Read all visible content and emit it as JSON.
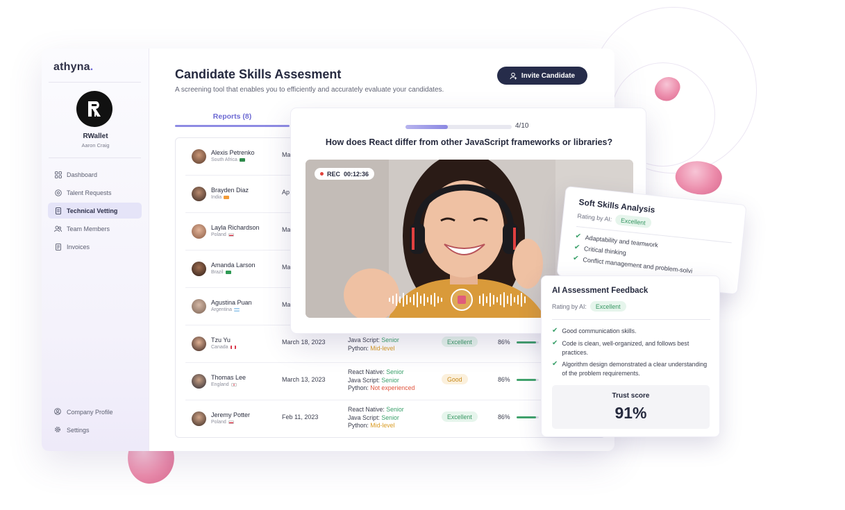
{
  "sidebar": {
    "logo": "athyna",
    "logo_dot": ".",
    "company": "RWallet",
    "person": "Aaron Craig",
    "nav": [
      {
        "label": "Dashboard",
        "icon": "grid-icon"
      },
      {
        "label": "Talent Requests",
        "icon": "target-icon"
      },
      {
        "label": "Technical Vetting",
        "icon": "document-icon",
        "active": true
      },
      {
        "label": "Team Members",
        "icon": "users-icon"
      },
      {
        "label": "Invoices",
        "icon": "invoice-icon"
      }
    ],
    "bottom": [
      {
        "label": "Company Profile",
        "icon": "profile-icon"
      },
      {
        "label": "Settings",
        "icon": "gear-icon"
      }
    ]
  },
  "header": {
    "title": "Candidate Skills Assesment",
    "subtitle": "A screening tool that enables you to efficiently and accurately evaluate your candidates.",
    "invite_label": "Invite Candidate"
  },
  "tabs": {
    "reports": "Reports (8)"
  },
  "candidates": [
    {
      "name": "Alexis Petrenko",
      "country": "South Africa",
      "date": "Ma",
      "flag": "#2f8a4b"
    },
    {
      "name": "Brayden Diaz",
      "country": "India",
      "date": "Ap",
      "flag": "#f29b38"
    },
    {
      "name": "Layla Richardson",
      "country": "Poland",
      "date": "Ma",
      "flag": "#d9374a"
    },
    {
      "name": "Amanda Larson",
      "country": "Brazil",
      "date": "Ma",
      "flag": "#2f9a54"
    },
    {
      "name": "Agustina Puan",
      "country": "Argentina",
      "date": "Ma",
      "flag": "#8fc3ea"
    },
    {
      "name": "Tzu Yu",
      "country": "Canada",
      "date": "March 18, 2023",
      "flag": "#d9374a",
      "skills": [
        {
          "lang": "Java Script:",
          "level": "Senior",
          "cls": "senior"
        },
        {
          "lang": "Python:",
          "level": "Mid-level",
          "cls": "mid"
        }
      ],
      "rating": "Excellent",
      "rating_cls": "ex",
      "pct": "86%",
      "pct_val": 0.86
    },
    {
      "name": "Thomas Lee",
      "country": "England",
      "date": "March 13, 2023",
      "flag": "#d9374a",
      "skills": [
        {
          "lang": "React Native:",
          "level": "Senior",
          "cls": "senior"
        },
        {
          "lang": "Java Script:",
          "level": "Senior",
          "cls": "senior"
        },
        {
          "lang": "Python:",
          "level": "Not experienced",
          "cls": "none"
        }
      ],
      "rating": "Good",
      "rating_cls": "gd",
      "pct": "86%",
      "pct_val": 0.86
    },
    {
      "name": "Jeremy Potter",
      "country": "Poland",
      "date": "Feb 11, 2023",
      "flag": "#d9374a",
      "skills": [
        {
          "lang": "React Native:",
          "level": "Senior",
          "cls": "senior"
        },
        {
          "lang": "Java Script:",
          "level": "Senior",
          "cls": "senior"
        },
        {
          "lang": "Python:",
          "level": "Mid-level",
          "cls": "mid"
        }
      ],
      "rating": "Excellent",
      "rating_cls": "ex",
      "pct": "86%",
      "pct_val": 0.86
    }
  ],
  "question": {
    "progress_text": "4/10",
    "progress": 0.4,
    "text": "How does React differ from other JavaScript frameworks or libraries?",
    "rec_label": "REC",
    "rec_time": "00:12:36"
  },
  "soft_skills": {
    "title": "Soft Skills Analysis",
    "rating_label": "Rating by AI:",
    "rating": "Excellent",
    "items": [
      "Adaptability and teamwork",
      "Critical thinking",
      "Conflict management and problem-solvi"
    ]
  },
  "ai_feedback": {
    "title": "AI Assessment Feedback",
    "rating_label": "Rating by AI:",
    "rating": "Excellent",
    "items": [
      "Good communication skills.",
      "Code is clean, well-organized, and follows best practices.",
      "Algorithm design demonstrated a clear understanding of the problem requirements."
    ],
    "trust_label": "Trust score",
    "trust_value": "91%"
  },
  "colors": {
    "accent": "#6c66d8",
    "primary_button": "#262c4a",
    "excellent": "#389763",
    "good": "#c88a1c",
    "not_experienced": "#e0523b"
  }
}
